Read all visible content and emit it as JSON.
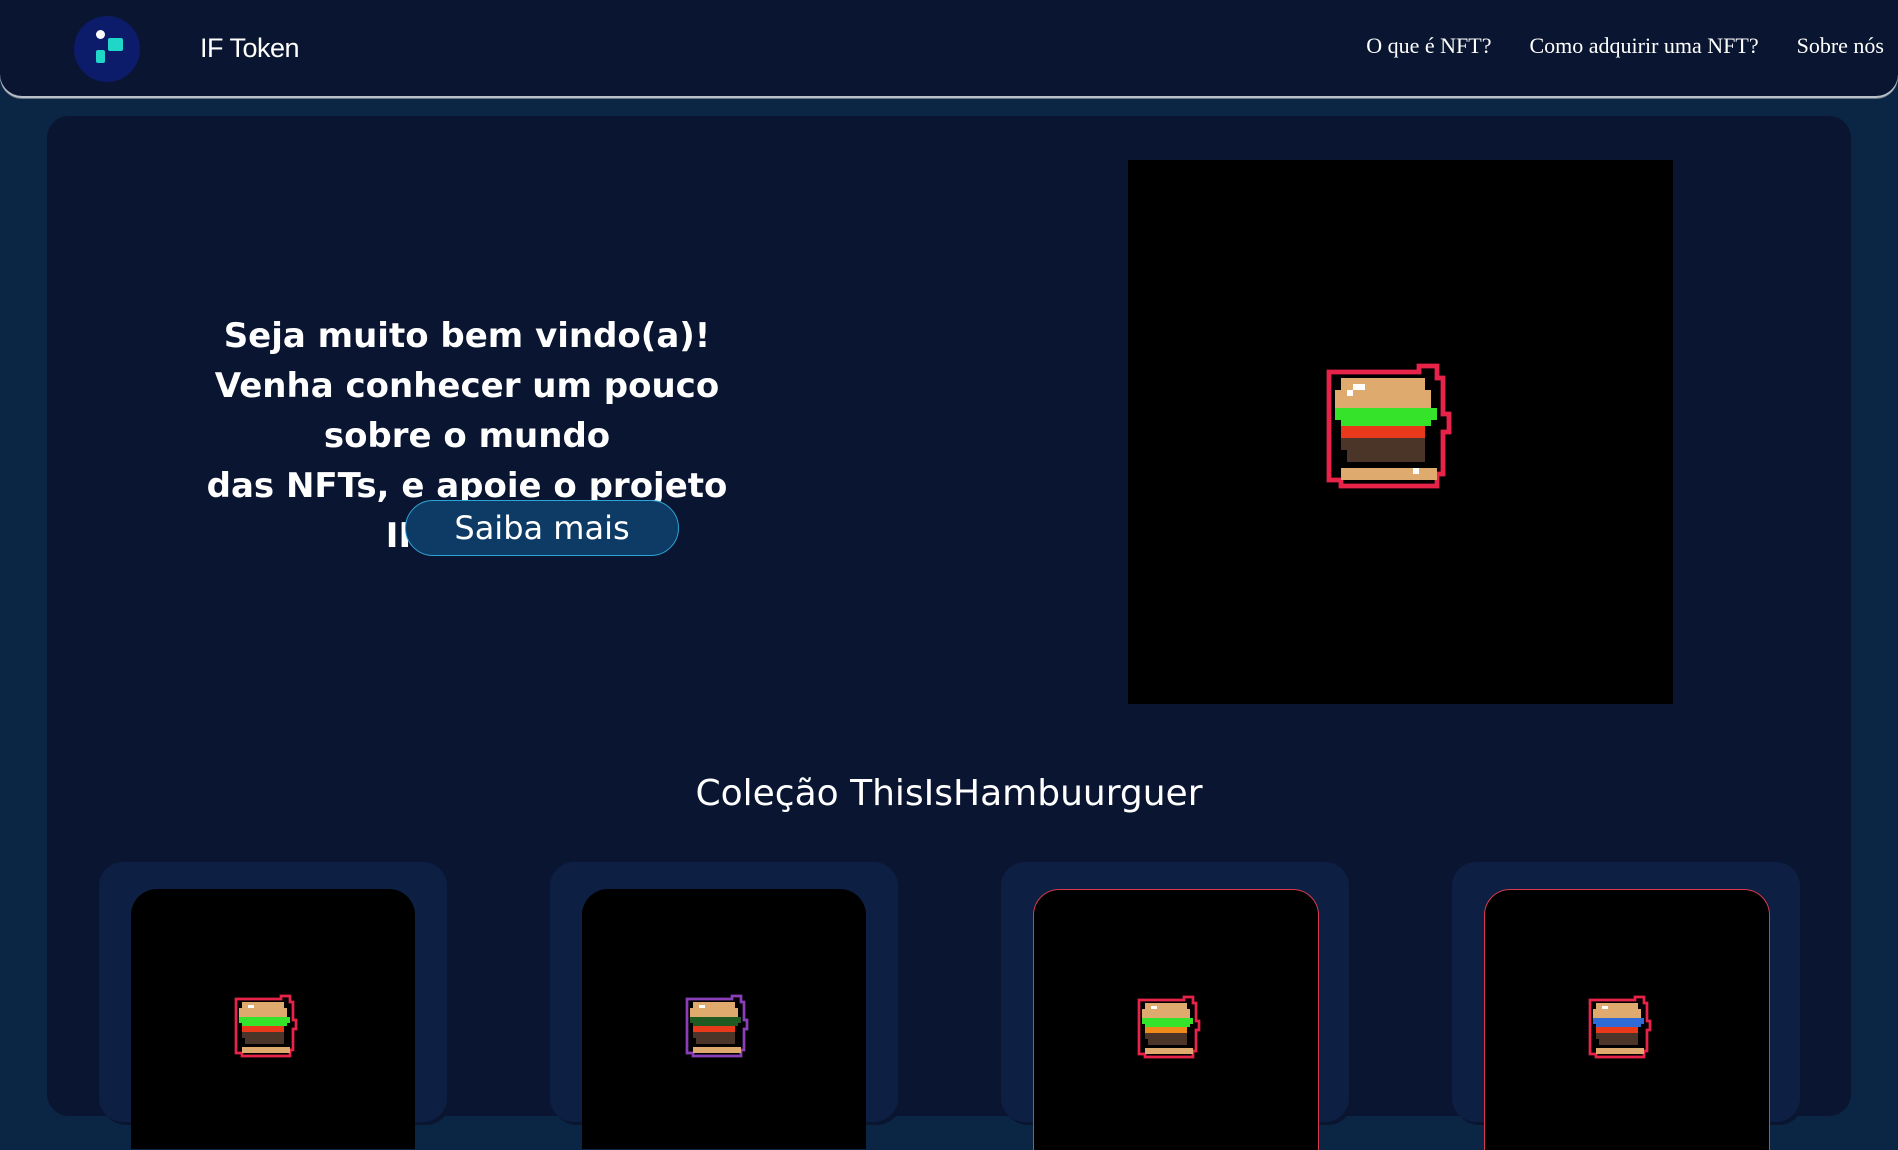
{
  "header": {
    "brand": "IF Token",
    "logo": "if-token-logo",
    "nav": [
      {
        "label": "O que é NFT?"
      },
      {
        "label": "Como adquirir uma NFT?"
      },
      {
        "label": "Sobre nós"
      }
    ]
  },
  "hero": {
    "line1": "Seja muito bem vindo(a)!",
    "line2": "Venha conhecer um pouco sobre o mundo",
    "line3": "das NFTs, e apoie o projeto IFToken!",
    "cta_label": "Saiba mais",
    "image": "pixel-hamburger-nft"
  },
  "collection": {
    "title": "Coleção ThisIsHambuurguer",
    "items": [
      {
        "image": "pixel-hamburger-nft",
        "outline_color": "#e8234a",
        "lettuce_color": "#35e42a"
      },
      {
        "image": "pixel-hamburger-nft",
        "outline_color": "#8a3fb8",
        "lettuce_color": "#1f5a22"
      },
      {
        "image": "pixel-hamburger-nft",
        "outline_color": "#e8234a",
        "lettuce_color": "#35e42a"
      },
      {
        "image": "pixel-hamburger-nft",
        "outline_color": "#e8234a",
        "lettuce_color": "#2f6bd6"
      }
    ]
  },
  "colors": {
    "page_bg": "#0b2545",
    "card_bg": "#0a1631",
    "accent": "#2fa4d6",
    "burger_outline": "#e8234a"
  }
}
